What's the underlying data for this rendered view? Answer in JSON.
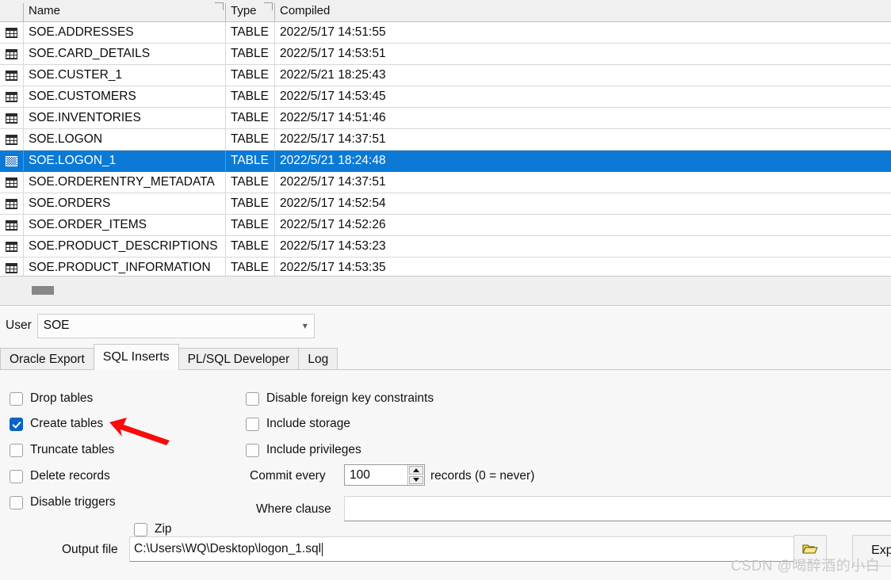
{
  "grid": {
    "columns": [
      "",
      "Name",
      "Type",
      "Compiled"
    ],
    "rows": [
      {
        "icon": "table-icon",
        "name": "SOE.ADDRESSES",
        "type": "TABLE",
        "compiled": "2022/5/17 14:51:55",
        "selected": false
      },
      {
        "icon": "table-icon",
        "name": "SOE.CARD_DETAILS",
        "type": "TABLE",
        "compiled": "2022/5/17 14:53:51",
        "selected": false
      },
      {
        "icon": "table-icon",
        "name": "SOE.CUSTER_1",
        "type": "TABLE",
        "compiled": "2022/5/21 18:25:43",
        "selected": false
      },
      {
        "icon": "table-icon",
        "name": "SOE.CUSTOMERS",
        "type": "TABLE",
        "compiled": "2022/5/17 14:53:45",
        "selected": false
      },
      {
        "icon": "table-icon",
        "name": "SOE.INVENTORIES",
        "type": "TABLE",
        "compiled": "2022/5/17 14:51:46",
        "selected": false
      },
      {
        "icon": "table-icon",
        "name": "SOE.LOGON",
        "type": "TABLE",
        "compiled": "2022/5/17 14:37:51",
        "selected": false
      },
      {
        "icon": "table-icon",
        "name": "SOE.LOGON_1",
        "type": "TABLE",
        "compiled": "2022/5/21 18:24:48",
        "selected": true
      },
      {
        "icon": "table-icon",
        "name": "SOE.ORDERENTRY_METADATA",
        "type": "TABLE",
        "compiled": "2022/5/17 14:37:51",
        "selected": false
      },
      {
        "icon": "table-icon",
        "name": "SOE.ORDERS",
        "type": "TABLE",
        "compiled": "2022/5/17 14:52:54",
        "selected": false
      },
      {
        "icon": "table-icon",
        "name": "SOE.ORDER_ITEMS",
        "type": "TABLE",
        "compiled": "2022/5/17 14:52:26",
        "selected": false
      },
      {
        "icon": "table-icon",
        "name": "SOE.PRODUCT_DESCRIPTIONS",
        "type": "TABLE",
        "compiled": "2022/5/17 14:53:23",
        "selected": false
      },
      {
        "icon": "table-icon",
        "name": "SOE.PRODUCT_INFORMATION",
        "type": "TABLE",
        "compiled": "2022/5/17 14:53:35",
        "selected": false
      }
    ],
    "selection_color": "#0a7ad6"
  },
  "user": {
    "label": "User",
    "value": "SOE"
  },
  "tabs": [
    {
      "label": "Oracle Export",
      "active": false
    },
    {
      "label": "SQL Inserts",
      "active": true
    },
    {
      "label": "PL/SQL Developer",
      "active": false
    },
    {
      "label": "Log",
      "active": false
    }
  ],
  "options": {
    "left_checkboxes": [
      {
        "label": "Drop tables",
        "checked": false
      },
      {
        "label": "Create tables",
        "checked": true
      },
      {
        "label": "Truncate tables",
        "checked": false
      },
      {
        "label": "Delete records",
        "checked": false
      },
      {
        "label": "Disable triggers",
        "checked": false
      }
    ],
    "right_checkboxes": [
      {
        "label": "Disable foreign key constraints",
        "checked": false
      },
      {
        "label": "Include storage",
        "checked": false
      },
      {
        "label": "Include privileges",
        "checked": false
      }
    ],
    "zip": {
      "label": "Zip",
      "checked": false
    },
    "commit_every": {
      "label": "Commit every",
      "value": "100",
      "suffix": "records (0 = never)"
    },
    "where_clause": {
      "label": "Where clause",
      "value": ""
    },
    "output_file": {
      "label": "Output file",
      "value": "C:\\Users\\WQ\\Desktop\\logon_1.sql"
    },
    "browse_icon": "open-folder-icon",
    "export_button": "Expor"
  },
  "annotation": {
    "arrow_color": "#fb0a0a"
  },
  "watermark": "CSDN @喝醉酒的小白"
}
